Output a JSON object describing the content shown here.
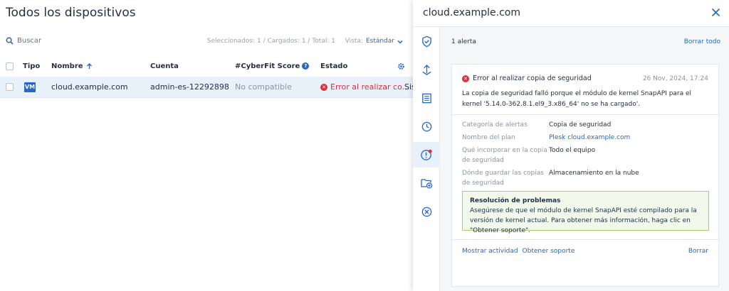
{
  "page": {
    "title": "Todos los dispositivos"
  },
  "toolbar": {
    "search_label": "Buscar",
    "stats": "Seleccionados: 1 / Cargados: 1 / Total: 1",
    "view_label": "Vista:",
    "view_value": "Estándar"
  },
  "table": {
    "headers": {
      "type": "Tipo",
      "name": "Nombre",
      "account": "Cuenta",
      "score": "#CyberFit Score",
      "status": "Estado"
    },
    "row": {
      "type_badge": "VM",
      "name": "cloud.example.com",
      "account": "admin-es-12292898",
      "score": "No compatible",
      "status": "Error al realizar co...",
      "overflow": "Sis"
    }
  },
  "panel": {
    "title": "cloud.example.com",
    "alert_count": "1 alerta",
    "clear_all": "Borrar todo",
    "alert": {
      "title": "Error al realizar copia de seguridad",
      "date": "26 Nov, 2024, 17:24",
      "message": "La copia de seguridad falló porque el módulo de kernel SnapAPI para el kernel '5.14.0-362.8.1.el9_3.x86_64' no se ha cargado'.",
      "fields": {
        "category_label": "Categoría de alertas",
        "category_value": "Copia de seguridad",
        "plan_label": "Nombre del plan",
        "plan_value": "Plesk cloud.example.com",
        "include_label": "Qué incorporar en la copia de seguridad",
        "include_value": "Todo el equipo",
        "where_label": "Dónde guardar las copias de seguridad",
        "where_value": "Almacenamiento en la nube"
      },
      "troubleshoot_title": "Resolución de problemas",
      "troubleshoot_text": "Asegúrese de que el módulo de kernel SnapAPI esté compilado para la versión de kernel actual. Para obtener más información, haga clic en \"Obtener soporte\".",
      "show_activity": "Mostrar actividad",
      "get_support": "Obtener soporte",
      "delete": "Borrar"
    }
  },
  "colors": {
    "accent": "#2668c5",
    "error": "#d8323f",
    "selected_row": "#e8f0fa",
    "trouble_bg": "#f3f9ea"
  },
  "rail_icons": [
    "shield-check-icon",
    "recovery-icon",
    "report-icon",
    "history-icon",
    "alert-icon",
    "folder-add-icon",
    "cancel-circle-icon"
  ]
}
